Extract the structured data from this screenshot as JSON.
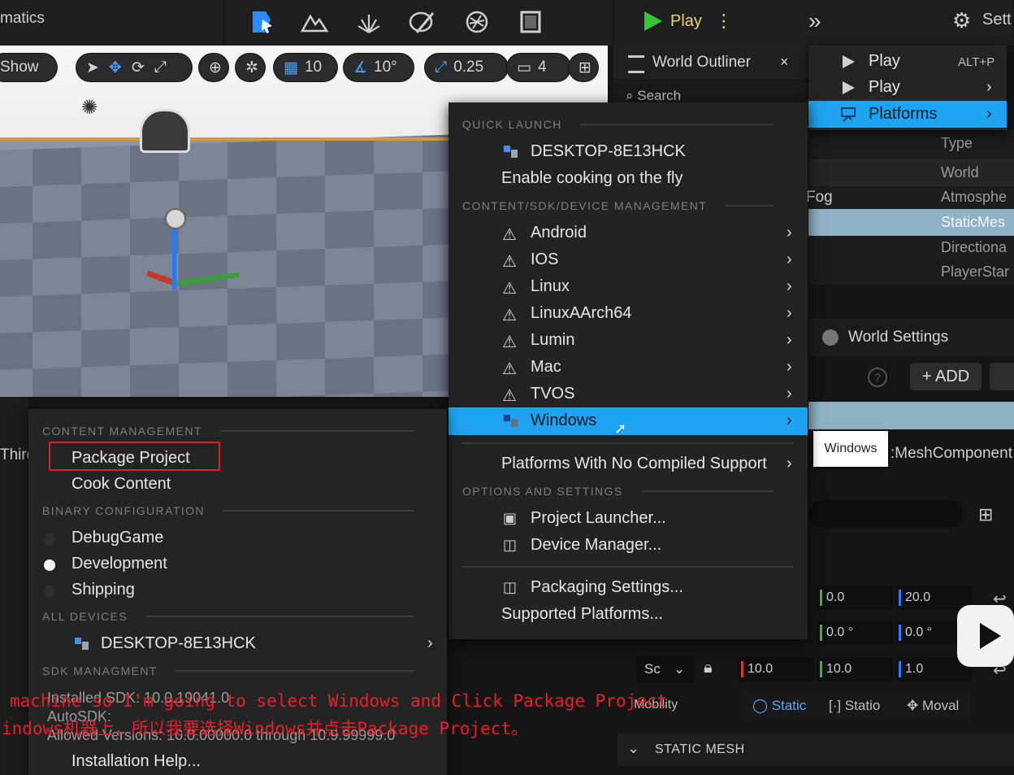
{
  "topbar": {
    "title_fragment": "matics",
    "play_label": "Play",
    "settings_fragment": "Sett"
  },
  "viewport": {
    "show_label": "Show",
    "grid_snap": "10",
    "rotation_snap": "10°",
    "scale_snap": "0.25",
    "camera_speed": "4"
  },
  "play_menu": {
    "items": [
      {
        "label": "Play",
        "shortcut": "ALT+P"
      },
      {
        "label": "Play",
        "shortcut": ""
      },
      {
        "label": "Platforms",
        "shortcut": ""
      }
    ]
  },
  "outliner": {
    "title": "World Outliner",
    "close": "×",
    "search_placeholder": "Search",
    "type_header": "Type",
    "rows": [
      "World",
      "Atmosphe",
      "StaticMes",
      "Directiona",
      "PlayerStar"
    ],
    "fog_label": "Fog"
  },
  "details": {
    "world_settings": "World Settings",
    "add_label": "+ ADD",
    "tooltip": "Windows",
    "component": ":MeshComponent",
    "location": [
      "0.0",
      "20.0"
    ],
    "rotation": [
      "0.0 °",
      "0.0 °"
    ],
    "scale": [
      "10.0",
      "10.0",
      "1.0"
    ],
    "scale_mode": "Sc",
    "mobility_label": "Mobility",
    "mobility_options": [
      "Static",
      "Statio",
      "Moval"
    ],
    "static_mesh_header": "STATIC MESH"
  },
  "platforms_menu": {
    "quick_launch_header": "QUICK LAUNCH",
    "quick_launch_device": "DESKTOP-8E13HCK",
    "enable_cooking": "Enable cooking on the fly",
    "content_sdk_header": "CONTENT/SDK/DEVICE MANAGEMENT",
    "platforms": [
      "Android",
      "IOS",
      "Linux",
      "LinuxAArch64",
      "Lumin",
      "Mac",
      "TVOS",
      "Windows"
    ],
    "no_compiled": "Platforms With No Compiled Support",
    "options_header": "OPTIONS AND SETTINGS",
    "project_launcher": "Project Launcher...",
    "device_manager": "Device Manager...",
    "packaging_settings": "Packaging Settings...",
    "supported_platforms": "Supported Platforms..."
  },
  "windows_submenu": {
    "content_header": "CONTENT MANAGEMENT",
    "package_project": "Package Project",
    "cook_content": "Cook Content",
    "binary_header": "BINARY CONFIGURATION",
    "configs": [
      "DebugGame",
      "Development",
      "Shipping"
    ],
    "selected_config": "Development",
    "all_devices_header": "ALL DEVICES",
    "device": "DESKTOP-8E13HCK",
    "sdk_header": "SDK MANAGMENT",
    "installed_sdk": "Installed SDK: 10.0.19041.0",
    "auto_sdk": "AutoSDK:",
    "allowed_versions": "Allowed Versions: 10.0.00000.0 through 10.9.99999.0",
    "installation_help": "Installation Help..."
  },
  "left_fragments": {
    "third": "Third"
  },
  "subtitles": {
    "english": "machine so I'm going to select Windows and Click Package Project",
    "chinese": "indows机器上，所以我要选择Windows并点击Package Project。"
  },
  "colors": {
    "highlight": "#1ea3f0",
    "accent_play": "#35c43a",
    "annotation_red": "#e02020"
  }
}
